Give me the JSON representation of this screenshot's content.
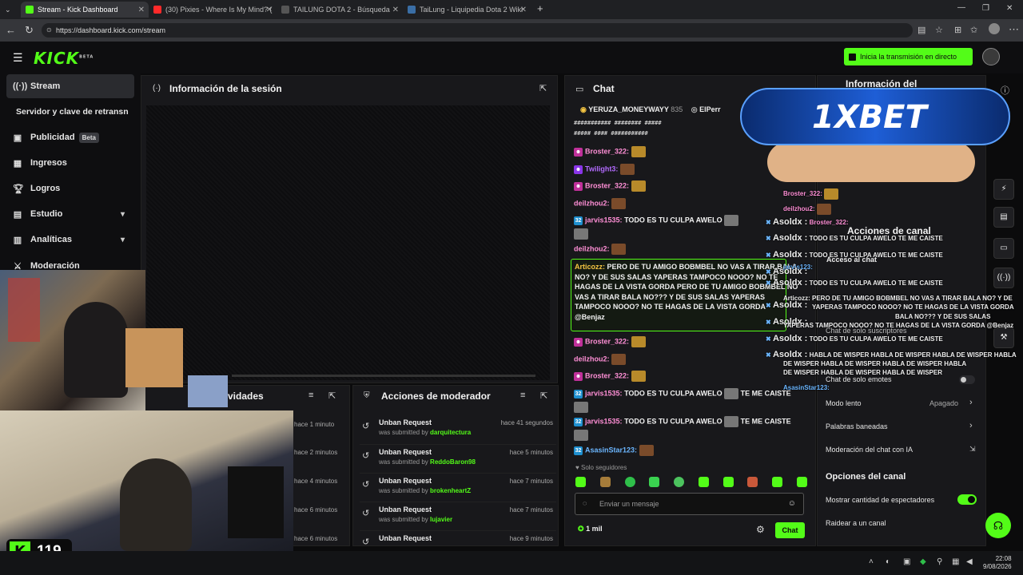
{
  "browser": {
    "tabs": [
      {
        "label": "Stream - Kick Dashboard",
        "active": true
      },
      {
        "label": "(30) Pixies - Where Is My Mind? (",
        "active": false
      },
      {
        "label": "TAILUNG DOTA 2 - Búsqueda",
        "active": false
      },
      {
        "label": "TaiLung - Liquipedia Dota 2 Wiki",
        "active": false
      }
    ],
    "url": "https://dashboard.kick.com/stream"
  },
  "header": {
    "logo": "KICK",
    "logo_badge": "BETA",
    "go_live_label": "Inicia la transmisión en directo"
  },
  "sidebar": {
    "items": [
      {
        "label": "Stream",
        "icon": "broadcast-icon"
      },
      {
        "label": "Servidor y clave de retransn",
        "icon": ""
      },
      {
        "label": "Publicidad",
        "icon": "ad-icon",
        "badge": "Beta"
      },
      {
        "label": "Ingresos",
        "icon": "chart-icon"
      },
      {
        "label": "Logros",
        "icon": "trophy-icon"
      },
      {
        "label": "Estudio",
        "icon": "studio-icon"
      },
      {
        "label": "Analíticas",
        "icon": "analytics-icon"
      },
      {
        "label": "Moderación",
        "icon": "shield-icon"
      }
    ]
  },
  "session": {
    "title": "Información de la sesión"
  },
  "activity": {
    "title_fragment": "vidades",
    "times": [
      "hace 1 minuto",
      "hace 2 minutos",
      "hace 4 minutos",
      "hace 6 minutos",
      "hace 6 minutos"
    ]
  },
  "moderator": {
    "title": "Acciones de moderador",
    "rows": [
      {
        "title": "Unban Request",
        "prefix": "was submitted by",
        "user": "darquitectura",
        "time": "hace 41 segundos"
      },
      {
        "title": "Unban Request",
        "prefix": "was submitted by",
        "user": "ReddoBaron98",
        "time": "hace 5 minutos"
      },
      {
        "title": "Unban Request",
        "prefix": "was submitted by",
        "user": "brokenheartZ",
        "time": "hace 7 minutos"
      },
      {
        "title": "Unban Request",
        "prefix": "was submitted by",
        "user": "lujavier",
        "time": "hace 7 minutos"
      },
      {
        "title": "Unban Request",
        "prefix": "was submitted by",
        "user": "",
        "time": "hace 9 minutos"
      }
    ]
  },
  "chat": {
    "title": "Chat",
    "pinned": [
      "YERUZA_MONEYWAYY",
      "835",
      "ElPerr"
    ],
    "ascii_art_1": "########### ######## #####",
    "ascii_art_2": "##### #### ###########",
    "messages": [
      {
        "user": "Broster_322:",
        "color": "#ff8fd6",
        "text": ""
      },
      {
        "user": "Twilight3:",
        "color": "#b36bff",
        "text": ""
      },
      {
        "user": "Broster_322:",
        "color": "#ff8fd6",
        "text": ""
      },
      {
        "user": "deilzhou2:",
        "color": "#ff8fd6",
        "text": ""
      },
      {
        "user": "jarvis1535:",
        "color": "#ff8fd6",
        "text": "TODO ES TU CULPA AWELO"
      },
      {
        "user": "deilzhou2:",
        "color": "#ff8fd6",
        "text": ""
      }
    ],
    "highlight_user": "Articozz:",
    "highlight_text": "PERO DE TU AMIGO BOBMBEL NO VAS A TIRAR BALA NO? Y DE SUS SALAS YAPERAS TAMPOCO NOOO? NO TE HAGAS DE LA VISTA GORDA PERO DE TU AMIGO BOBMBEL NO VAS A TIRAR BALA NO??? Y DE SUS SALAS YAPERAS TAMPOCO NOOO? NO TE HAGAS DE LA VISTA GORDA @Benjaz",
    "highlight_lines": [
      "PERO DE TU AMIGO BOBMBEL NO VAS A TIRAR BALA",
      "NO? Y DE SUS SALAS YAPERAS TAMPOCO NOOO? NO TE",
      "HAGAS DE LA VISTA GORDA PERO DE TU AMIGO BOBMBEL NO",
      "VAS A TIRAR BALA NO??? Y DE SUS SALAS YAPERAS",
      "TAMPOCO NOOO? NO TE HAGAS DE LA VISTA GORDA",
      "@Benjaz"
    ],
    "messages2": [
      {
        "user": "Broster_322:",
        "color": "#ff8fd6"
      },
      {
        "user": "deilzhou2:",
        "color": "#ff8fd6"
      },
      {
        "user": "Broster_322:",
        "color": "#ff8fd6"
      }
    ],
    "jarvis_user": "jarvis1535:",
    "jarvis_text": "TODO ES TU CULPA AWELO",
    "jarvis_tail": "TE ME CAISTE",
    "asasin_user": "AsasinStar123:",
    "followers_only": "Solo seguidores",
    "input_placeholder": "Enviar un mensaje",
    "viewer_count": "1 mil",
    "send_label": "Chat"
  },
  "right_panel": {
    "title": "Información del",
    "channel_actions": "Acciones de canal",
    "chat_access": "Acceso al chat",
    "items": [
      {
        "label": "Chat de solo suscriptores"
      },
      {
        "label": "Chat de solo emotes"
      },
      {
        "label": "Modo lento",
        "value": "Apagado"
      },
      {
        "label": "Palabras baneadas"
      },
      {
        "label": "Moderación del chat con IA"
      }
    ],
    "channel_options": "Opciones del canal",
    "show_viewers": "Mostrar cantidad de espectadores",
    "raid": "Raidear a un canal"
  },
  "overlay": {
    "brand": "1XBET",
    "viewer_badge": "119",
    "lines": [
      "Broster_322:",
      "deilzhou2:",
      "Broster_322:",
      "Asoldx :",
      "Asoldx :",
      "Asoldx :",
      "Asoldx :",
      "Asoldx :",
      "Asoldx :",
      "Asoldx :",
      "Asoldx :"
    ],
    "chat_texts": [
      "TODO ES TU CULPA AWELO",
      "TE ME CAISTE",
      "TODO ES TU CULPA AWELO",
      "TE ME CAISTE",
      "TODO ES TU CULPA AWELO",
      "TE ME CAISTE",
      "TODO ES TU CULPA AWELO",
      "TE ME CAISTE"
    ],
    "articozz": "Articozz: PERO DE TU AMIGO BOBMBEL NO VAS A TIRAR BALA NO? Y DE",
    "articozz2": "YAPERAS TAMPOCO NOOO? NO TE HAGAS DE LA VISTA GORDA",
    "articozz3": "BALA NO??? Y DE SUS SALAS",
    "articozz4": "YAPERAS TAMPOCO NOOO? NO TE HAGAS DE LA VISTA GORDA @Benjaz",
    "wisper1": "HABLA DE WISPER HABLA DE WISPER HABLA DE WISPER HABLA",
    "wisper2": "DE WISPER HABLA DE WISPER HABLA DE WISPER HABLA",
    "wisper3": "DE WISPER HABLA DE WISPER HABLA DE WISPER",
    "asasin": "AsasinStar123:",
    "jarvis_user": "jarvis123:"
  },
  "taskbar": {
    "time": "22:08",
    "date": "9/08/2026"
  }
}
